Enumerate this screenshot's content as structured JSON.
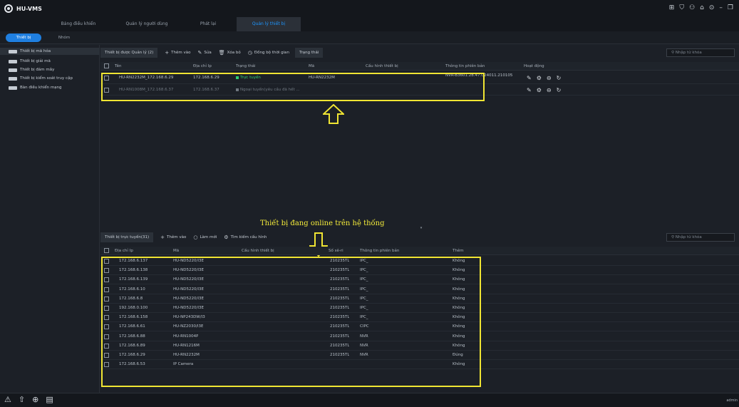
{
  "app": {
    "title": "HU-VMS"
  },
  "main_tabs": [
    {
      "label": "Bảng điều khiển"
    },
    {
      "label": "Quản lý người dùng"
    },
    {
      "label": "Phát lại"
    },
    {
      "label": "Quản lý thiết bị"
    }
  ],
  "sub_tabs": {
    "active": "Thiết bị",
    "inactive": "Nhóm"
  },
  "sidebar": {
    "items": [
      {
        "label": "Thiết bị mã hóa"
      },
      {
        "label": "Thiết bị giải mã"
      },
      {
        "label": "Thiết bị đám mây"
      },
      {
        "label": "Thiết bị kiểm soát truy cập"
      },
      {
        "label": "Bàn điều khiển mạng"
      }
    ]
  },
  "managed": {
    "toolbar": {
      "title": "Thiết bị được Quản lý (2)",
      "add": "Thêm vào",
      "edit": "Sửa",
      "delete": "Xóa bỏ",
      "sync": "Đồng bộ thời gian",
      "status": "Trạng thái"
    },
    "search_placeholder": "Nhập từ khóa",
    "columns": [
      "Tên",
      "Địa chỉ Ip",
      "Trạng thái",
      "Mã",
      "Cấu hình thiết bị",
      "Thông tin phiên bản",
      "Hoạt động"
    ],
    "rows": [
      {
        "name": "HU-RN2232M_172.168.6.29",
        "ip": "172.168.6.29",
        "status": "Trực tuyến",
        "model": "HU-RN2232M",
        "config": "",
        "version": "NVR-B3601.28.47.C24011.210105"
      },
      {
        "name": "HU-RN1008M_172.168.6.37",
        "ip": "172.168.6.37",
        "status": "Ngoại tuyến(yêu cầu đã hết ...",
        "model": "",
        "config": "",
        "version": ""
      }
    ]
  },
  "online": {
    "toolbar": {
      "title": "Thiết bị trực tuyến(31)",
      "add": "Thêm vào",
      "refresh": "Làm mới",
      "search_config": "Tìm kiếm cấu hình"
    },
    "search_placeholder": "Nhập từ khóa",
    "columns": [
      "Địa chỉ Ip",
      "Mã",
      "Cấu hình thiết bị",
      "Số sê-ri",
      "Thông tin phiên bản",
      "Thêm"
    ],
    "rows": [
      {
        "ip": "172.168.6.137",
        "model": "HU-ND5220/I3E",
        "serial": "210235TL",
        "version": "IPC_",
        "added": "Không"
      },
      {
        "ip": "172.168.6.138",
        "model": "HU-ND5220/I3E",
        "serial": "210235TL",
        "version": "IPC_",
        "added": "Không"
      },
      {
        "ip": "172.168.6.139",
        "model": "HU-ND5220/I3E",
        "serial": "210235TL",
        "version": "IPC_",
        "added": "Không"
      },
      {
        "ip": "172.168.6.10",
        "model": "HU-ND5220/I3E",
        "serial": "210235TL",
        "version": "IPC_",
        "added": "Không"
      },
      {
        "ip": "172.168.6.8",
        "model": "HU-ND5220/I3E",
        "serial": "210235TL",
        "version": "IPC_",
        "added": "Không"
      },
      {
        "ip": "192.168.0.100",
        "model": "HU-ND5220/I3E",
        "serial": "210235TL",
        "version": "IPC_",
        "added": "Không"
      },
      {
        "ip": "172.168.6.158",
        "model": "HU-NP243DW/I3",
        "serial": "210235TL",
        "version": "IPC_",
        "added": "Không"
      },
      {
        "ip": "172.168.6.61",
        "model": "HU-NZ2030/I3E",
        "serial": "210235TL",
        "version": "CIPC",
        "added": "Không"
      },
      {
        "ip": "172.168.6.88",
        "model": "HU-RN1004P",
        "serial": "210235TL",
        "version": "NVR",
        "added": "Không"
      },
      {
        "ip": "172.168.6.89",
        "model": "HU-RN1216M",
        "serial": "210235TL",
        "version": "NVR",
        "added": "Không"
      },
      {
        "ip": "172.168.6.29",
        "model": "HU-RN2232M",
        "serial": "210235TL",
        "version": "NVR",
        "added": "Đúng"
      },
      {
        "ip": "172.168.6.53",
        "model": "IP Camera",
        "serial": "",
        "version": "",
        "added": "Không"
      }
    ]
  },
  "annotation": {
    "text": "Thiết bị đang online trên hệ thống"
  },
  "status_bar": {
    "user": "admin"
  },
  "colors": {
    "accent": "#1f7fe0",
    "online": "#2ecc71",
    "highlight": "#f0e533"
  }
}
